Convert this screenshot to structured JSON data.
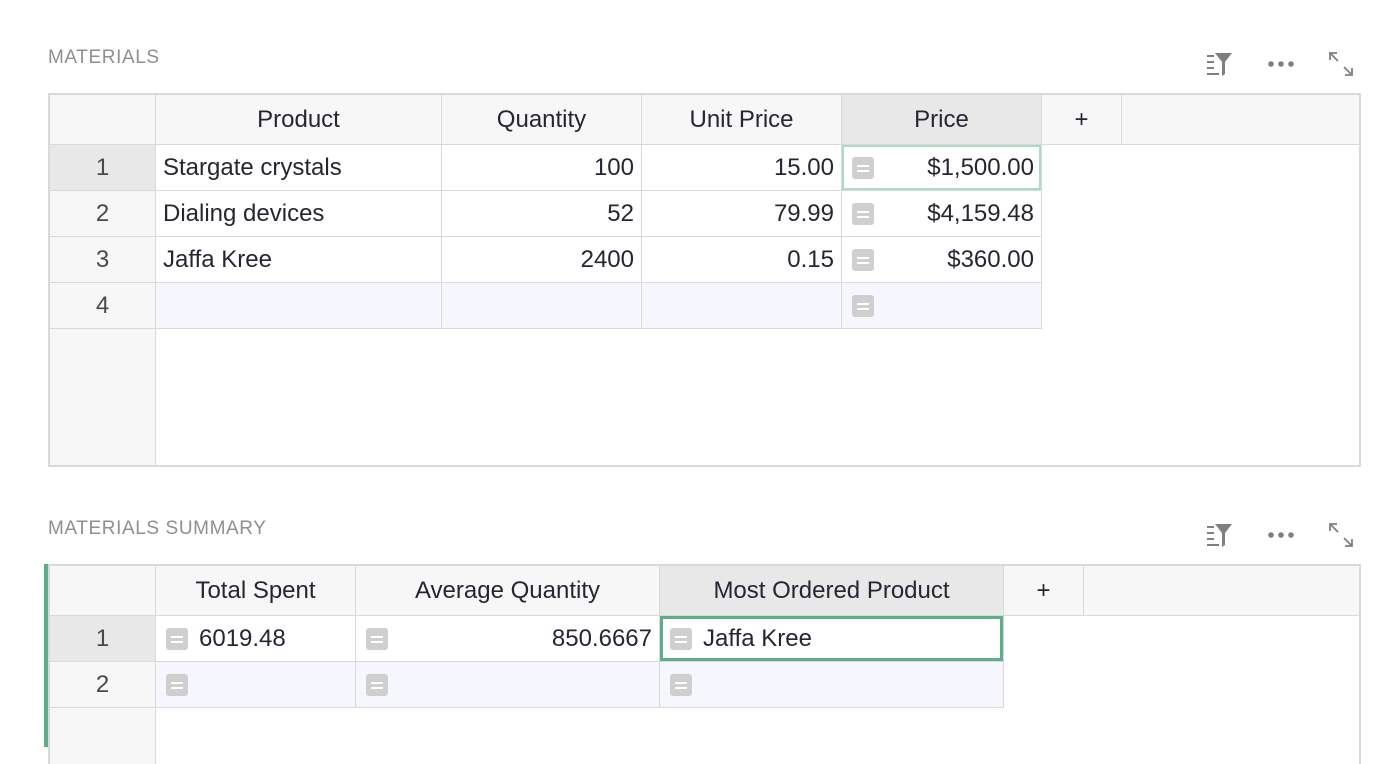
{
  "sections": [
    {
      "title": "MATERIALS",
      "columns": [
        "Product",
        "Quantity",
        "Unit Price",
        "Price"
      ],
      "add_column_label": "+",
      "rows": [
        {
          "num": "1",
          "product": "Stargate crystals",
          "quantity": "100",
          "unit_price": "15.00",
          "price": "$1,500.00"
        },
        {
          "num": "2",
          "product": "Dialing devices",
          "quantity": "52",
          "unit_price": "79.99",
          "price": "$4,159.48"
        },
        {
          "num": "3",
          "product": "Jaffa Kree",
          "quantity": "2400",
          "unit_price": "0.15",
          "price": "$360.00"
        },
        {
          "num": "4",
          "product": "",
          "quantity": "",
          "unit_price": "",
          "price": ""
        }
      ]
    },
    {
      "title": "MATERIALS SUMMARY",
      "columns": [
        "Total Spent",
        "Average Quantity",
        "Most Ordered Product"
      ],
      "add_column_label": "+",
      "rows": [
        {
          "num": "1",
          "total_spent": "6019.48",
          "average_quantity": "850.6667",
          "most_ordered_product": "Jaffa Kree"
        },
        {
          "num": "2",
          "total_spent": "",
          "average_quantity": "",
          "most_ordered_product": ""
        }
      ]
    }
  ],
  "toolbar_icons": [
    "sort-filter-icon",
    "more-options-icon",
    "expand-icon"
  ],
  "colors": {
    "accent": "#5aaf86",
    "cursor_light": "#a9dcc5",
    "header_bg": "#f7f7f7",
    "new_row_bg": "#f6f6fe"
  }
}
